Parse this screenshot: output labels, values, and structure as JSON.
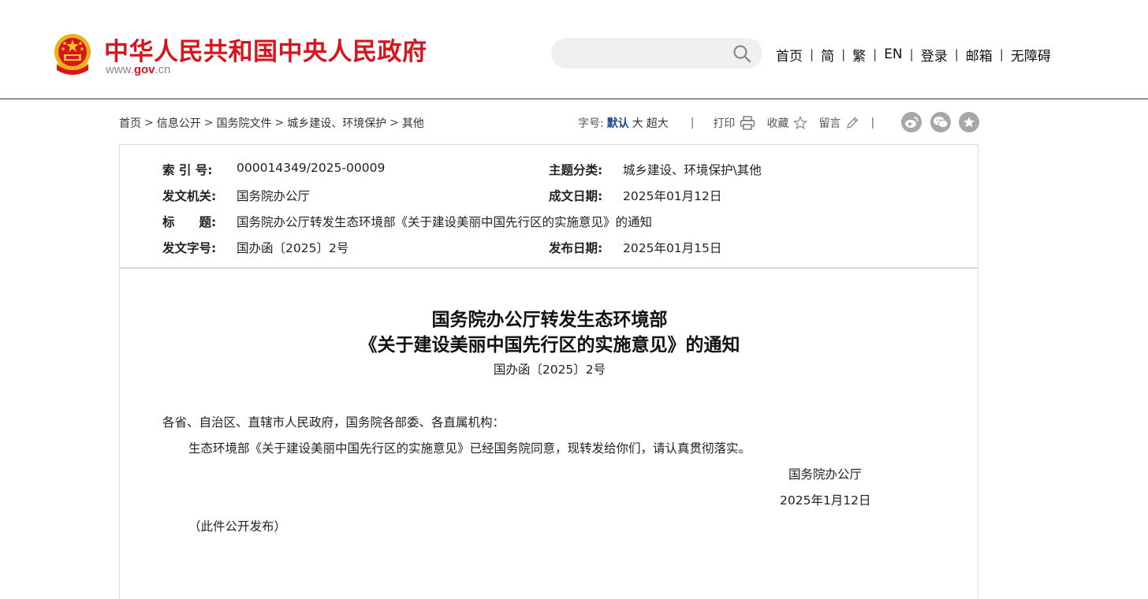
{
  "header": {
    "site_name": "中华人民共和国中央人民政府",
    "domain_prefix": "www.",
    "domain_gov": "gov",
    "domain_suffix": ".cn",
    "search_placeholder": "",
    "nav": [
      "首页",
      "简",
      "繁",
      "EN",
      "登录",
      "邮箱",
      "无障碍"
    ]
  },
  "breadcrumb": [
    "首页",
    "信息公开",
    "国务院文件",
    "城乡建设、环境保护",
    "其他"
  ],
  "tools": {
    "font_label": "字号:",
    "font_sizes": [
      "默认",
      "大",
      "超大"
    ],
    "active_font": "默认",
    "print": "打印",
    "favorite": "收藏",
    "comment": "留言"
  },
  "share_icons": [
    "weibo-icon",
    "wechat-icon",
    "star-share-icon"
  ],
  "meta": {
    "index_no_label": "索 引 号:",
    "index_no": "000014349/2025-00009",
    "category_label": "主题分类:",
    "category": "城乡建设、环境保护\\其他",
    "issuer_label": "发文机关:",
    "issuer": "国务院办公厅",
    "written_date_label": "成文日期:",
    "written_date": "2025年01月12日",
    "title_label": "标　　题:",
    "title": "国务院办公厅转发生态环境部《关于建设美丽中国先行区的实施意见》的通知",
    "doc_no_label": "发文字号:",
    "doc_no": "国办函〔2025〕2号",
    "publish_date_label": "发布日期:",
    "publish_date": "2025年01月15日"
  },
  "article": {
    "title_line1": "国务院办公厅转发生态环境部",
    "title_line2": "《关于建设美丽中国先行区的实施意见》的通知",
    "doc_no": "国办函〔2025〕2号",
    "salutation": "各省、自治区、直辖市人民政府，国务院各部委、各直属机构：",
    "body": "生态环境部《关于建设美丽中国先行区的实施意见》已经国务院同意，现转发给你们，请认真贯彻落实。",
    "signature": "国务院办公厅",
    "date": "2025年1月12日",
    "note": "（此件公开发布）"
  },
  "colors": {
    "brand_red": "#d8141c",
    "header_rule": "#1f3a56",
    "active_link": "#1b4a86",
    "share_icon_bg": "#a7a7a7"
  }
}
